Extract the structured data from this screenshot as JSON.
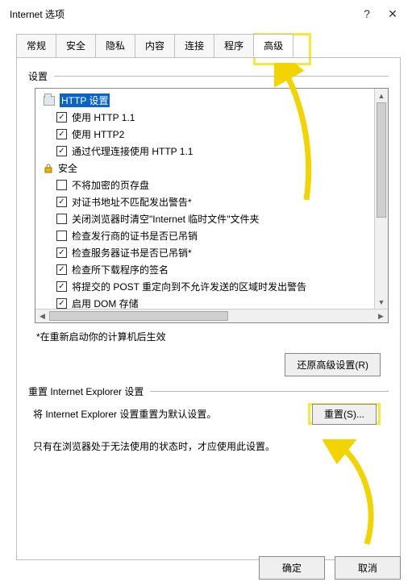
{
  "window": {
    "title": "Internet 选项",
    "help_symbol": "?",
    "close_symbol": "✕"
  },
  "tabs": [
    {
      "label": "常规"
    },
    {
      "label": "安全"
    },
    {
      "label": "隐私"
    },
    {
      "label": "内容"
    },
    {
      "label": "连接"
    },
    {
      "label": "程序"
    },
    {
      "label": "高级",
      "active": true
    }
  ],
  "settings": {
    "group_label": "设置",
    "items": [
      {
        "type": "header",
        "icon": "folder",
        "label": "HTTP 设置",
        "selected": true
      },
      {
        "type": "check",
        "checked": true,
        "label": "使用 HTTP 1.1"
      },
      {
        "type": "check",
        "checked": true,
        "label": "使用 HTTP2"
      },
      {
        "type": "check",
        "checked": true,
        "label": "通过代理连接使用 HTTP 1.1"
      },
      {
        "type": "header",
        "icon": "lock",
        "label": "安全"
      },
      {
        "type": "check",
        "checked": false,
        "label": "不将加密的页存盘"
      },
      {
        "type": "check",
        "checked": true,
        "label": "对证书地址不匹配发出警告*"
      },
      {
        "type": "check",
        "checked": false,
        "label": "关闭浏览器时清空\"Internet 临时文件\"文件夹"
      },
      {
        "type": "check",
        "checked": false,
        "label": "检查发行商的证书是否已吊销"
      },
      {
        "type": "check",
        "checked": true,
        "label": "检查服务器证书是否已吊销*"
      },
      {
        "type": "check",
        "checked": true,
        "label": "检查所下载程序的签名"
      },
      {
        "type": "check",
        "checked": true,
        "label": "将提交的 POST 重定向到不允许发送的区域时发出警告"
      },
      {
        "type": "check",
        "checked": true,
        "label": "启用 DOM 存储"
      }
    ],
    "restart_note": "*在重新启动你的计算机后生效",
    "restore_button": "还原高级设置(R)"
  },
  "reset": {
    "group_label": "重置 Internet Explorer 设置",
    "description": "将 Internet Explorer 设置重置为默认设置。",
    "button": "重置(S)...",
    "info": "只有在浏览器处于无法使用的状态时，才应使用此设置。"
  },
  "dialog_buttons": {
    "ok": "确定",
    "cancel": "取消"
  }
}
